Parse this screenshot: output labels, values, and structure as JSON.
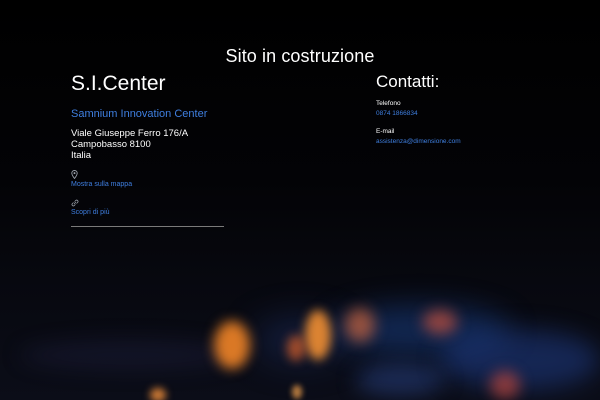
{
  "colors": {
    "background": "#000000",
    "text": "#ffffff",
    "link": "#3f7fe0"
  },
  "page": {
    "title": "Sito in costruzione"
  },
  "company": {
    "name": "S.I.Center",
    "subtitle": "Samnium Innovation Center",
    "address_lines": [
      "Viale Giuseppe Ferro 176/A",
      "Campobasso 8100",
      "Italia"
    ],
    "map_icon": "map-pin-icon",
    "map_link": "Mostra sulla mappa",
    "more_icon": "link-icon",
    "more_link": "Scopri di più"
  },
  "contacts": {
    "title": "Contatti:",
    "phone_label": "Telefono",
    "phone_value": "0874 1866834",
    "email_label": "E-mail",
    "email_value": "assistenza@dimensione.com"
  }
}
